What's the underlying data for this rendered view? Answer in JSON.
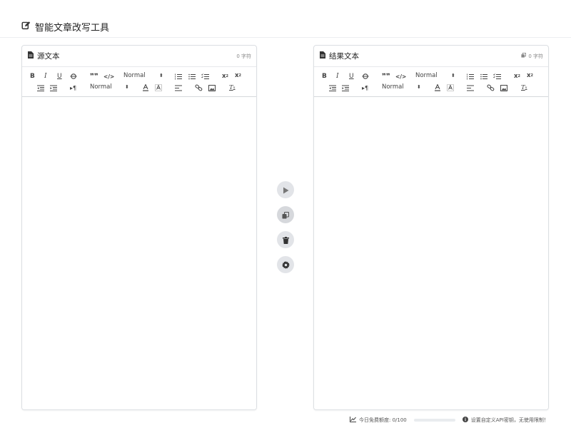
{
  "app": {
    "title": "智能文章改写工具",
    "title_icon": "edit-icon"
  },
  "source_panel": {
    "title": "源文本",
    "count": "0 字符",
    "toolbar": {
      "header_select": "Normal",
      "size_select": "Normal"
    }
  },
  "result_panel": {
    "title": "结果文本",
    "count": "0 字符",
    "toolbar": {
      "header_select": "Normal",
      "size_select": "Normal"
    }
  },
  "actions": [
    "rewrite-play-icon",
    "copy-icon",
    "trash-icon",
    "settings-gear-icon"
  ],
  "footer": {
    "quota_label": "今日免费额度: 0/100",
    "quota_fraction": 0,
    "hint": "设置自定义API密钥，无使用限制！"
  },
  "colors": {
    "border": "#dcdfe3",
    "button_bg": "#e2e4e8",
    "icon_dark": "#333333"
  }
}
